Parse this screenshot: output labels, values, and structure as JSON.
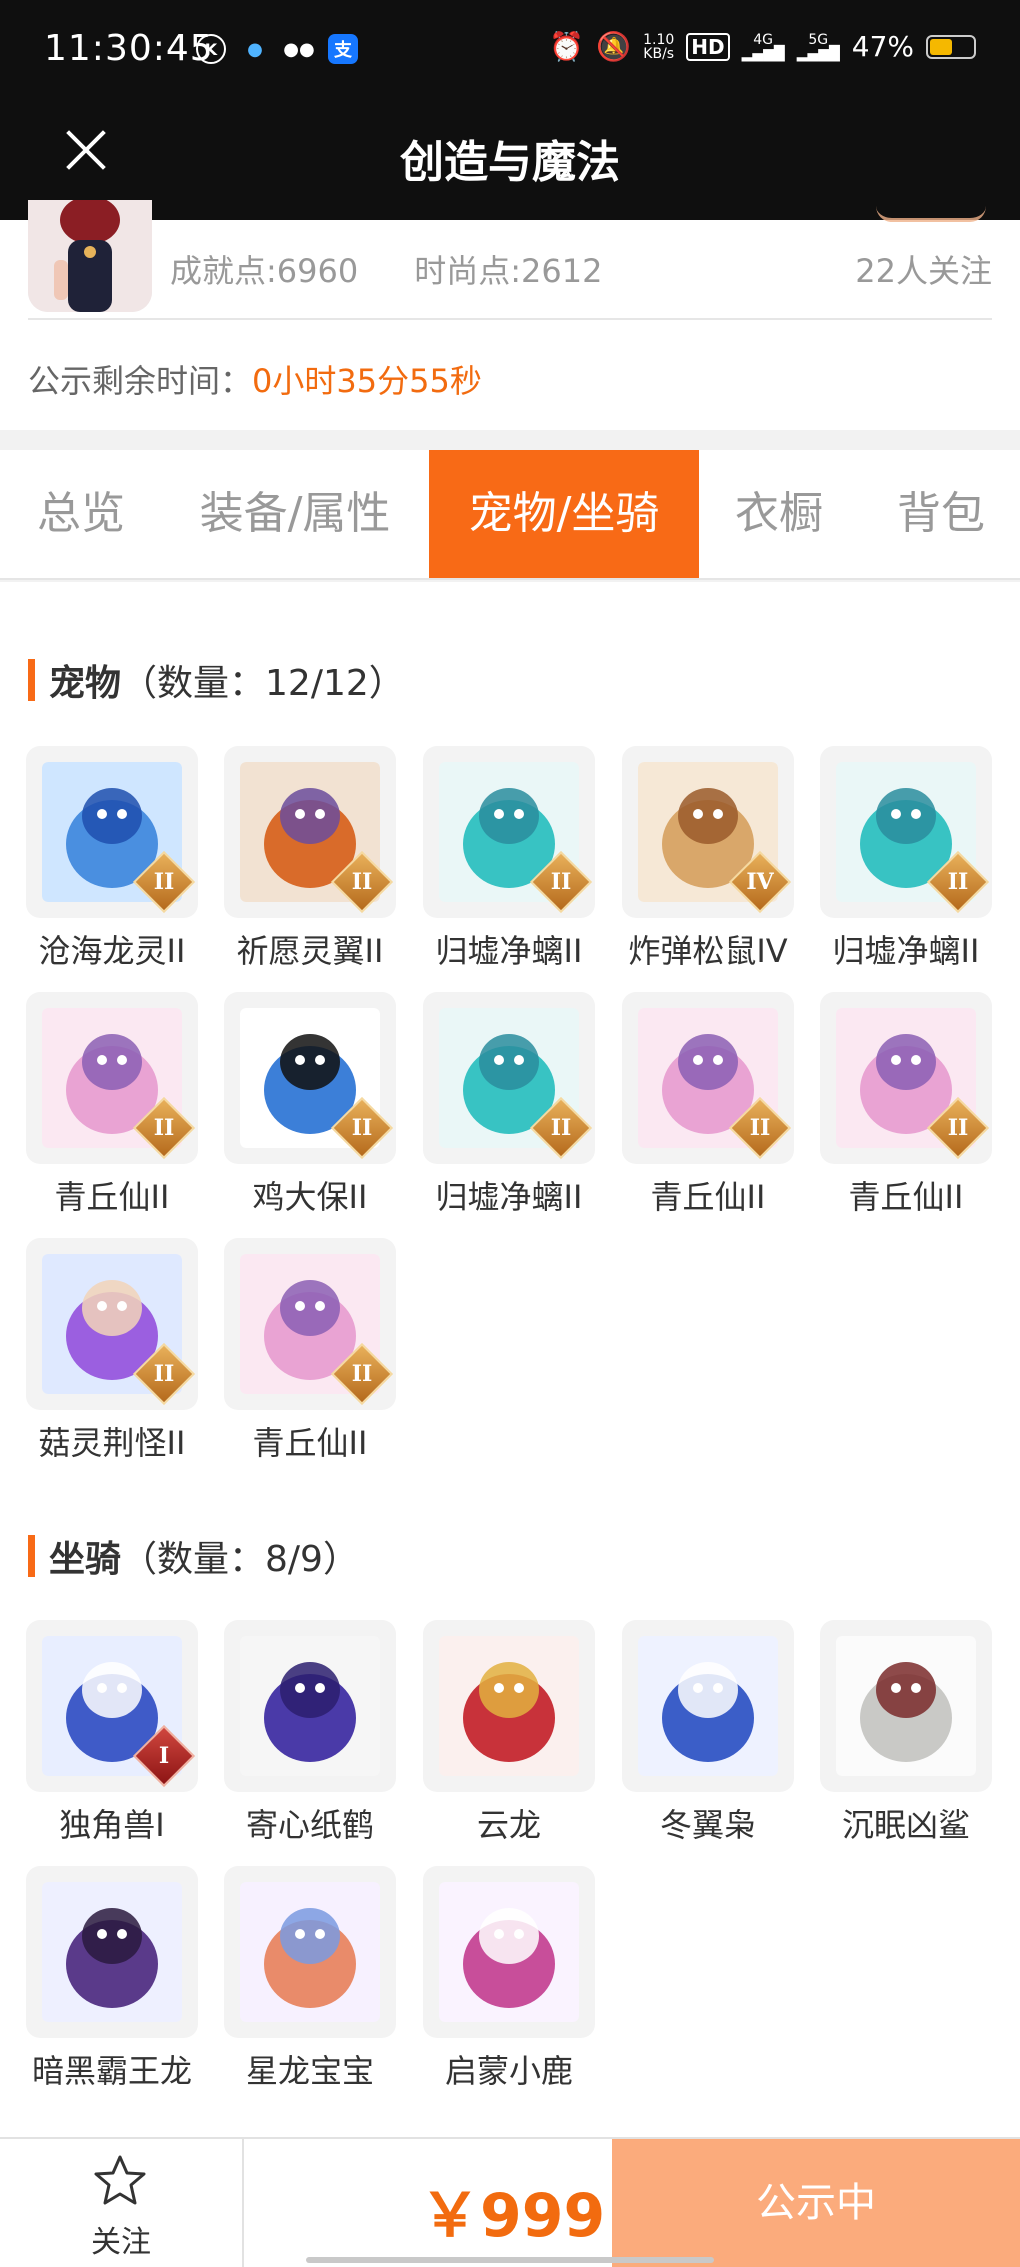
{
  "status_bar": {
    "time": "11:30:45",
    "net_speed": "1.10",
    "net_unit": "KB/s",
    "hd": "HD",
    "sig1": "4G",
    "sig2": "5G",
    "battery": "47%",
    "battery_level": 0.47
  },
  "header": {
    "title": "创造与魔法"
  },
  "seller": {
    "achievement": "成就点:6960",
    "fashion": "时尚点:2612",
    "followers": "22人关注",
    "countdown_label": "公示剩余时间：",
    "countdown_value": "0小时35分55秒"
  },
  "tabs": [
    {
      "label": "总览"
    },
    {
      "label": "装备/属性"
    },
    {
      "label": "宠物/坐骑"
    },
    {
      "label": "衣橱"
    },
    {
      "label": "背包"
    }
  ],
  "active_tab": 2,
  "pets": {
    "title": "宠物",
    "count": "（数量：12/12）",
    "items": [
      {
        "name": "沧海龙灵II",
        "tier": "II",
        "icon": "blue-dragon-girl"
      },
      {
        "name": "祈愿灵翼II",
        "tier": "II",
        "icon": "griffin"
      },
      {
        "name": "归墟净螭II",
        "tier": "II",
        "icon": "teal-dragon"
      },
      {
        "name": "炸弹松鼠IV",
        "tier": "IV",
        "icon": "squirrel"
      },
      {
        "name": "归墟净螭II",
        "tier": "II",
        "icon": "teal-dragon"
      },
      {
        "name": "青丘仙II",
        "tier": "II",
        "icon": "fox-fairy"
      },
      {
        "name": "鸡大保II",
        "tier": "II",
        "icon": "blue-chicken"
      },
      {
        "name": "归墟净螭II",
        "tier": "II",
        "icon": "teal-dragon"
      },
      {
        "name": "青丘仙II",
        "tier": "II",
        "icon": "fox-fairy"
      },
      {
        "name": "青丘仙II",
        "tier": "II",
        "icon": "fox-fairy"
      },
      {
        "name": "菇灵荆怪II",
        "tier": "II",
        "icon": "mushroom-sprite"
      },
      {
        "name": "青丘仙II",
        "tier": "II",
        "icon": "fox-fairy"
      }
    ]
  },
  "mounts": {
    "title": "坐骑",
    "count": "（数量：8/9）",
    "items": [
      {
        "name": "独角兽I",
        "tier": "I",
        "icon": "unicorn"
      },
      {
        "name": "寄心纸鹤",
        "tier": "",
        "icon": "paper-crane"
      },
      {
        "name": "云龙",
        "tier": "",
        "icon": "cloud-dragon"
      },
      {
        "name": "冬翼枭",
        "tier": "",
        "icon": "snow-owl"
      },
      {
        "name": "沉眠凶鲨",
        "tier": "",
        "icon": "shark"
      },
      {
        "name": "暗黑霸王龙",
        "tier": "",
        "icon": "dark-trex"
      },
      {
        "name": "星龙宝宝",
        "tier": "",
        "icon": "star-dragon-baby"
      },
      {
        "name": "启蒙小鹿",
        "tier": "",
        "icon": "little-deer"
      }
    ]
  },
  "footer": {
    "follow_label": "关注",
    "price": "￥999",
    "status_label": "公示中"
  },
  "colors": {
    "accent": "#f86a16",
    "status_button": "#fbab7c",
    "header_bg": "#0f0f0f"
  }
}
